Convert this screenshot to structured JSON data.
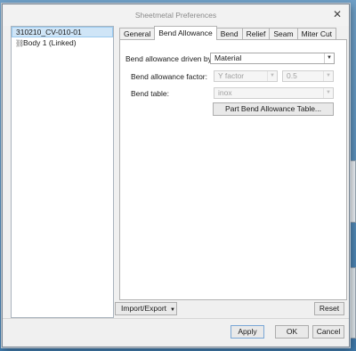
{
  "window": {
    "title": "Sheetmetal Preferences"
  },
  "tree": {
    "items": [
      {
        "label": "310210_CV-010-01"
      },
      {
        "label": "Body 1 (Linked)"
      }
    ]
  },
  "tabs": [
    {
      "label": "General"
    },
    {
      "label": "Bend Allowance"
    },
    {
      "label": "Bend"
    },
    {
      "label": "Relief"
    },
    {
      "label": "Seam"
    },
    {
      "label": "Miter Cut"
    }
  ],
  "bend_allowance": {
    "driven_by_label": "Bend allowance driven by:",
    "driven_by_value": "Material",
    "factor_label": "Bend allowance factor:",
    "factor_type": "Y factor",
    "factor_value": "0.5",
    "table_label": "Bend table:",
    "table_value": "inox",
    "part_table_button": "Part Bend Allowance Table..."
  },
  "footer": {
    "import_export": "Import/Export",
    "reset": "Reset",
    "apply": "Apply",
    "ok": "OK",
    "cancel": "Cancel"
  }
}
